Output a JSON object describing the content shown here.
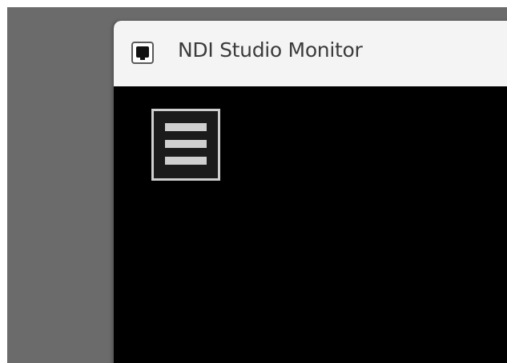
{
  "window": {
    "title": "NDI Studio Monitor"
  },
  "icons": {
    "app": "monitor-icon",
    "menu": "hamburger-menu-icon"
  },
  "colors": {
    "desktop": "#6b6b6b",
    "titlebar": "#f4f4f4",
    "content": "#000000",
    "menu_button_border": "#cfcfcf"
  }
}
